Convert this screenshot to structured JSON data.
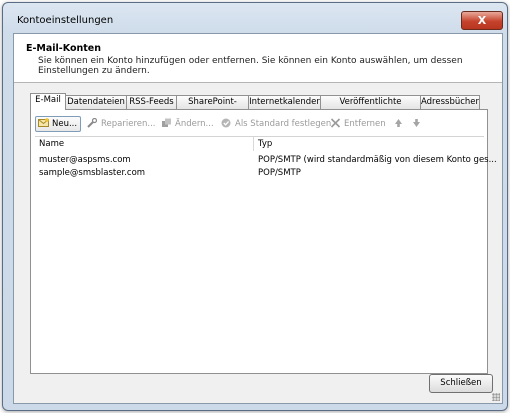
{
  "window": {
    "title": "Kontoeinstellungen",
    "close_label": "X"
  },
  "header": {
    "title": "E-Mail-Konten",
    "description": "Sie können ein Konto hinzufügen oder entfernen. Sie können ein Konto auswählen, um dessen Einstellungen zu ändern."
  },
  "tabs": [
    {
      "label": "E-Mail",
      "active": true
    },
    {
      "label": "Datendateien"
    },
    {
      "label": "RSS-Feeds"
    },
    {
      "label": "SharePoint-Listen"
    },
    {
      "label": "Internetkalender"
    },
    {
      "label": "Veröffentlichte Kalender"
    },
    {
      "label": "Adressbücher"
    }
  ],
  "toolbar": {
    "new_label": "Neu...",
    "repair_label": "Reparieren...",
    "change_label": "Ändern...",
    "default_label": "Als Standard festlegen",
    "remove_label": "Entfernen"
  },
  "table": {
    "columns": [
      "Name",
      "Typ"
    ],
    "rows": [
      {
        "name": "muster@aspsms.com",
        "type": "POP/SMTP (wird standardmäßig von diesem Konto ges..."
      },
      {
        "name": "sample@smsblaster.com",
        "type": "POP/SMTP"
      }
    ]
  },
  "footer": {
    "close_label": "Schließen"
  },
  "icons": [
    "new-account-icon",
    "wrench-icon",
    "change-icon",
    "checkmark-icon",
    "remove-x-icon",
    "arrow-up-icon",
    "arrow-down-icon"
  ]
}
